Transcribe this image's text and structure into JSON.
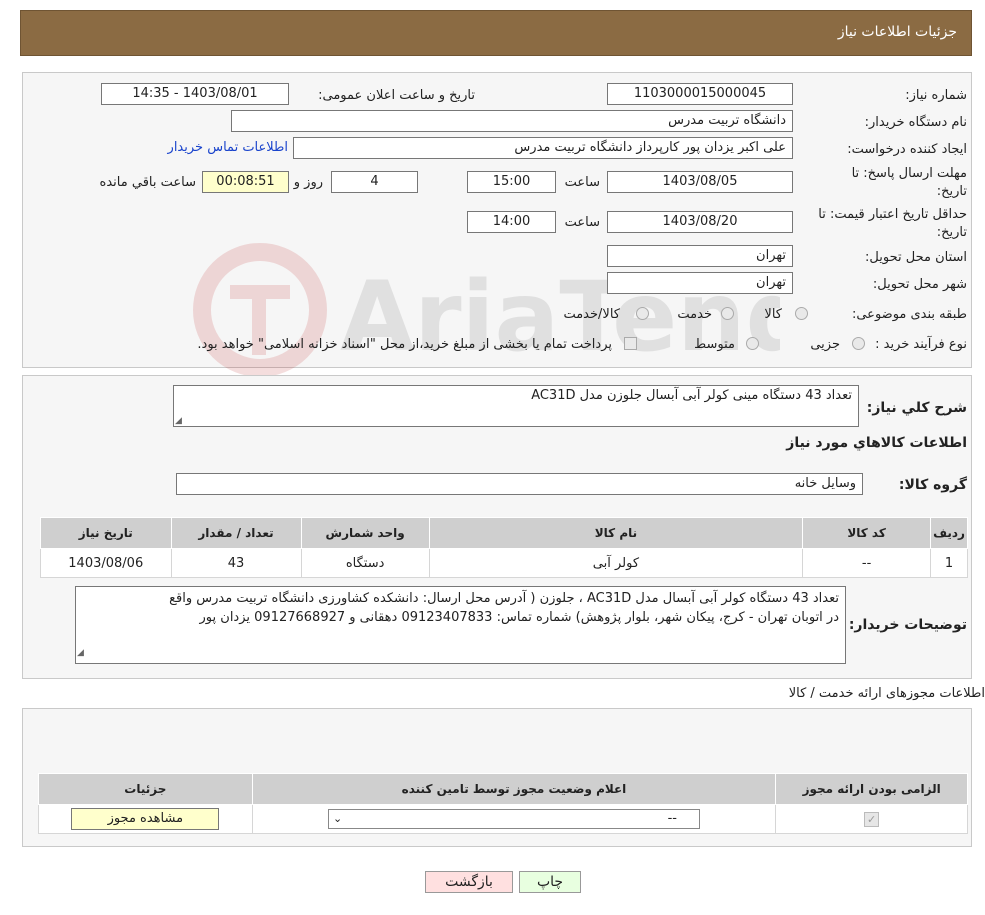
{
  "header": {
    "title": "جزئیات اطلاعات نیاز"
  },
  "form": {
    "need_number": {
      "label": "شماره نیاز:",
      "value": "1103000015000045"
    },
    "announce": {
      "label": "تاریخ و ساعت اعلان عمومی:",
      "value": "1403/08/01 - 14:35"
    },
    "buyer_org": {
      "label": "نام دستگاه خریدار:",
      "value": "دانشگاه تربیت مدرس"
    },
    "requester": {
      "label": "ایجاد کننده درخواست:",
      "value": "علی اکبر یزدان پور کارپرداز دانشگاه تربیت مدرس",
      "contact_link": "اطلاعات تماس خریدار"
    },
    "deadline": {
      "label_line1": "مهلت ارسال پاسخ: تا",
      "label_line2": "تاریخ:",
      "date": "1403/08/05",
      "time_label": "ساعت",
      "time": "15:00",
      "days": "4",
      "days_label": "روز و",
      "remaining": "00:08:51",
      "remaining_label": "ساعت باقي مانده"
    },
    "validity": {
      "label_line1": "حداقل تاریخ اعتبار قیمت: تا",
      "label_line2": "تاریخ:",
      "date": "1403/08/20",
      "time_label": "ساعت",
      "time": "14:00"
    },
    "province": {
      "label": "استان محل تحویل:",
      "value": "تهران"
    },
    "city": {
      "label": "شهر محل تحویل:",
      "value": "تهران"
    },
    "category": {
      "label": "طبقه بندی موضوعی:",
      "options": [
        "کالا",
        "خدمت",
        "کالا/خدمت"
      ]
    },
    "purchase_type": {
      "label": "نوع فرآیند خرید :",
      "options": [
        "جزیی",
        "متوسط"
      ],
      "note": "پرداخت تمام یا بخشی از مبلغ خرید،از محل \"اسناد خزانه اسلامی\" خواهد بود."
    }
  },
  "summary": {
    "label": "شرح كلي نياز:",
    "value": "تعداد 43 دستگاه مینی کولر آبی آبسال جلوزن مدل AC31D",
    "goods_title": "اطلاعات كالاهاي مورد نياز",
    "group_label": "گروه کالا:",
    "group_value": "وسایل خانه"
  },
  "goods_table": {
    "headers": [
      "ردیف",
      "کد کالا",
      "نام کالا",
      "واحد شمارش",
      "تعداد / مقدار",
      "تاریخ نیاز"
    ],
    "rows": [
      [
        "1",
        "--",
        "کولر آبی",
        "دستگاه",
        "43",
        "1403/08/06"
      ]
    ]
  },
  "buyer_notes": {
    "label": "توضیحات خریدار:",
    "line1": "تعداد 43 دستگاه کولر آبی آبسال مدل AC31D ، جلوزن ( آدرس محل ارسال: دانشکده کشاورزی دانشگاه تربیت مدرس واقع",
    "line2": "در اتوبان تهران - کرج، پیکان شهر، بلوار پژوهش) شماره تماس: 09123407833 دهقانی  و  09127668927 یزدان پور"
  },
  "permits": {
    "title": "اطلاعات مجوزهای ارائه خدمت / کالا",
    "headers": [
      "الزامی بودن ارائه مجوز",
      "اعلام وضعیت مجوز توسط تامین کننده",
      "جزئیات"
    ],
    "select_value": "--",
    "view_button": "مشاهده مجوز"
  },
  "footer": {
    "print": "چاپ",
    "back": "بازگشت"
  },
  "colors": {
    "header_bg": "#8b6b43",
    "link": "#1a44cc",
    "back_btn": "#ffe0e0",
    "print_btn": "#e8ffe0"
  }
}
